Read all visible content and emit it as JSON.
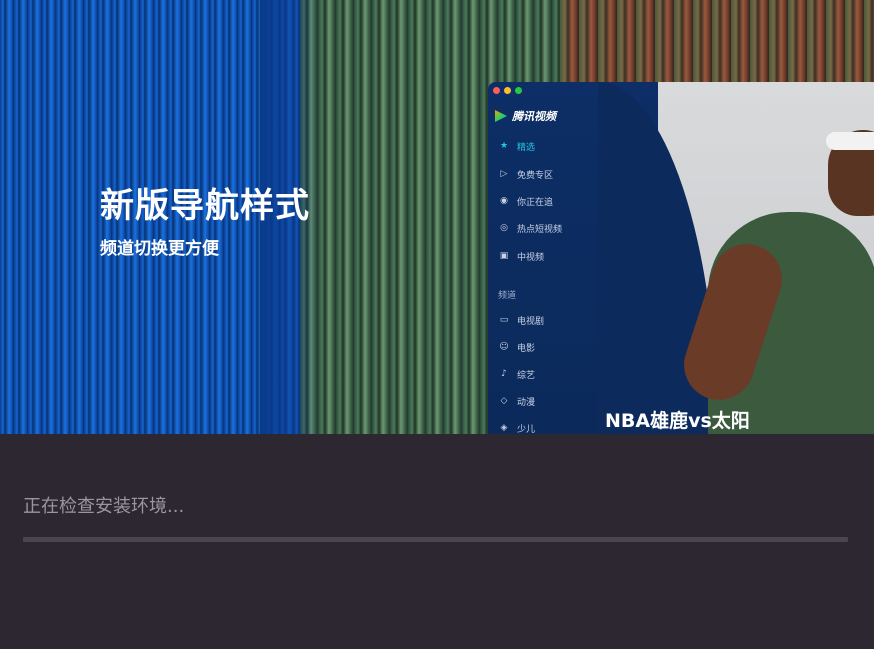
{
  "banner": {
    "headline": "新版导航样式",
    "subline": "频道切换更方便",
    "watermark": "",
    "hero_caption": "NBA雄鹿vs太阳"
  },
  "app": {
    "brand": "腾讯视频",
    "nav_items": [
      {
        "label": "精选",
        "icon": "star-icon",
        "active": true
      },
      {
        "label": "免费专区",
        "icon": "play-icon"
      },
      {
        "label": "你正在追",
        "icon": "eye-icon"
      },
      {
        "label": "热点短视频",
        "icon": "compass-icon"
      },
      {
        "label": "中视频",
        "icon": "video-icon"
      }
    ],
    "section_label": "频道",
    "channel_items": [
      {
        "label": "电视剧",
        "icon": "tv-icon"
      },
      {
        "label": "电影",
        "icon": "film-icon"
      },
      {
        "label": "综艺",
        "icon": "mic-icon"
      },
      {
        "label": "动漫",
        "icon": "shield-icon"
      },
      {
        "label": "少儿",
        "icon": "kids-icon"
      }
    ],
    "colors": {
      "accent": "#21c6e0",
      "sidebar_bg": "#0d2e66"
    }
  },
  "installer": {
    "status_text": "正在检查安装环境...",
    "progress": 0
  },
  "colors": {
    "background": "#2c2731",
    "track": "#4a4650"
  }
}
